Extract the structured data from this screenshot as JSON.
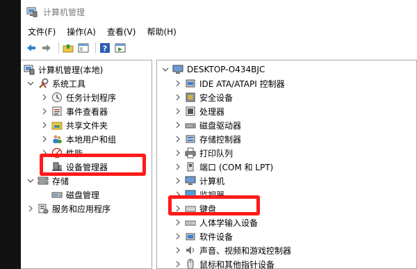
{
  "window": {
    "title": "计算机管理"
  },
  "menu": [
    "文件(F)",
    "操作(A)",
    "查看(V)",
    "帮助(H)"
  ],
  "toolbar": {
    "buttons": [
      "back-arrow-icon",
      "forward-arrow-icon",
      "up-folder-icon",
      "show-hide-tree-icon",
      "help-icon",
      "properties-icon"
    ]
  },
  "left_tree": {
    "root": "计算机管理(本地)",
    "system_tools": "系统工具",
    "task_scheduler": "任务计划程序",
    "event_viewer": "事件查看器",
    "shared_folders": "共享文件夹",
    "local_users": "本地用户和组",
    "performance": "性能",
    "device_manager": "设备管理器",
    "storage": "存储",
    "disk_management": "磁盘管理",
    "services_apps": "服务和应用程序"
  },
  "right_tree": {
    "root": "DESKTOP-O434BJC",
    "items": [
      "IDE ATA/ATAPI 控制器",
      "安全设备",
      "处理器",
      "磁盘驱动器",
      "存储控制器",
      "打印队列",
      "端口 (COM 和 LPT)",
      "计算机",
      "监视器",
      "键盘",
      "人体学输入设备",
      "软件设备",
      "声音、视频和游戏控制器",
      "鼠标和其他指针设备"
    ]
  },
  "colors": {
    "highlight": "#ff1a1a",
    "accent_blue": "#2d7fd3"
  }
}
